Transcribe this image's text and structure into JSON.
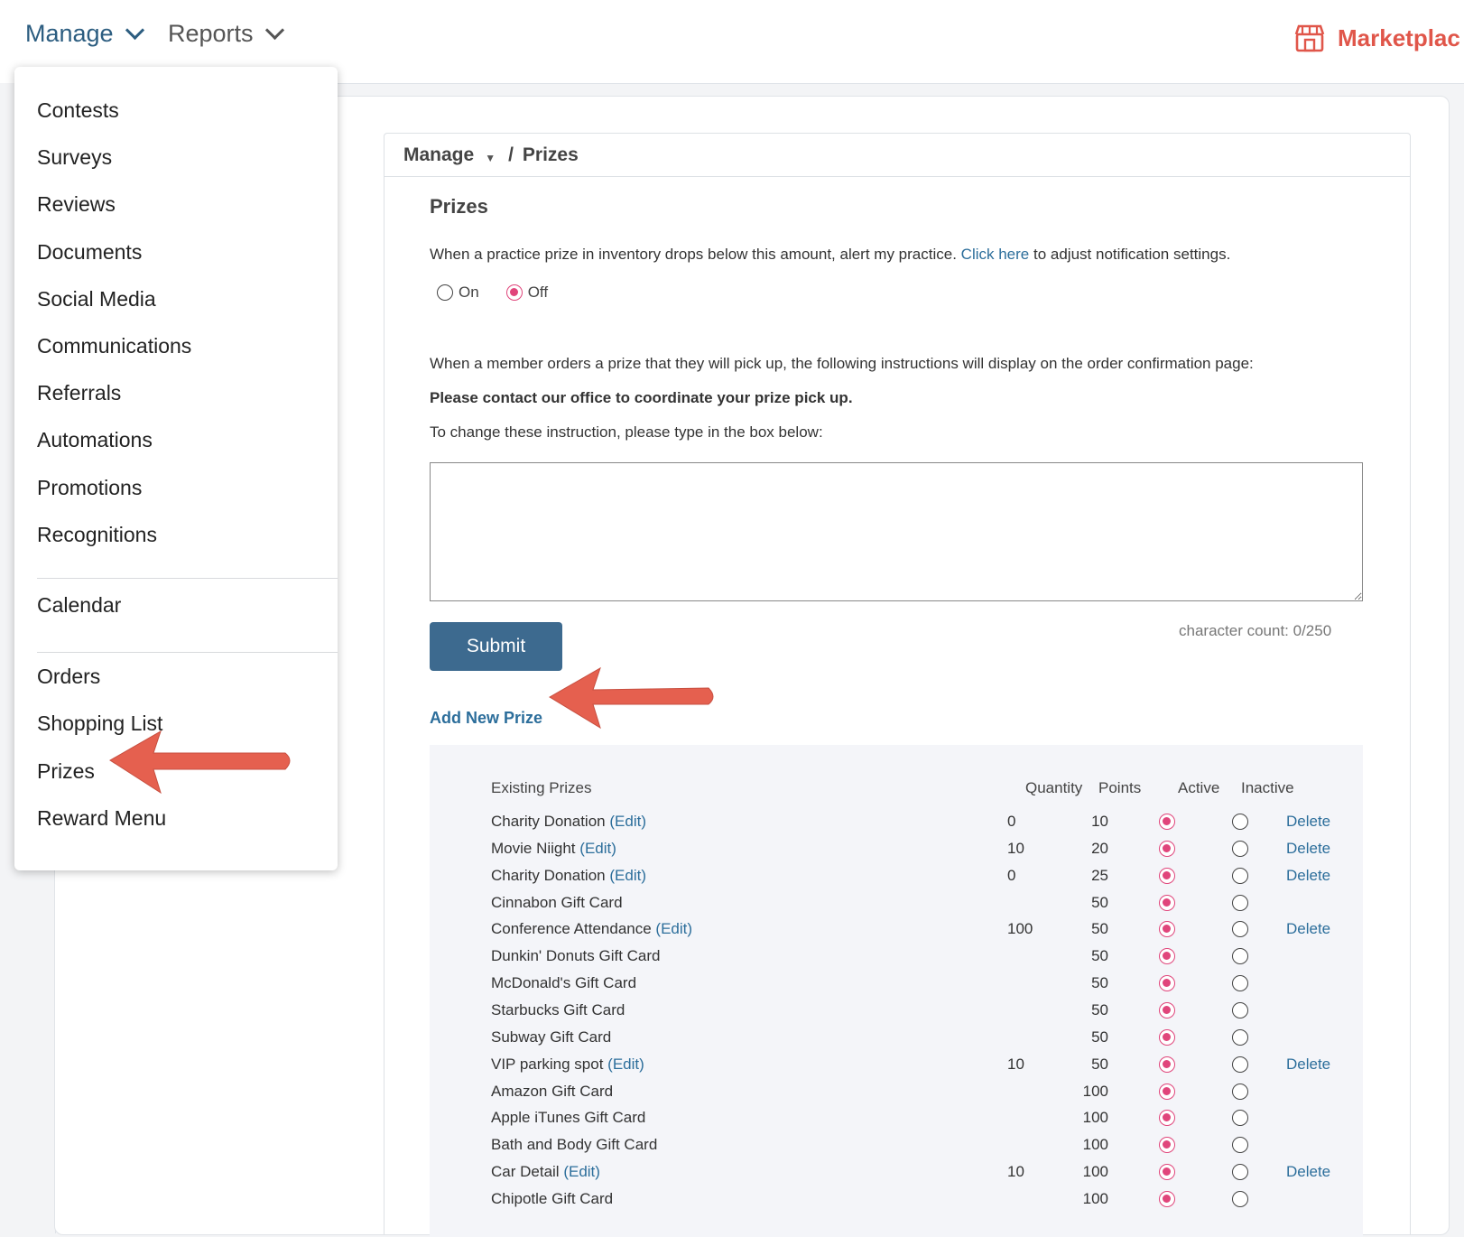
{
  "nav": {
    "manage_label": "Manage",
    "reports_label": "Reports",
    "marketplace_label": "Marketplac"
  },
  "breadcrumb": {
    "parent": "Manage",
    "separator": "/",
    "current": "Prizes"
  },
  "page": {
    "title": "Prizes",
    "alert_text_before": "When a practice prize in inventory drops below this amount, alert my practice.",
    "alert_link": "Click here",
    "alert_text_after": "to adjust notification settings.",
    "radio_on_label": "On",
    "radio_off_label": "Off",
    "pickup_intro": "When a member orders a prize that they will pick up, the following instructions will display on the order confirmation page:",
    "pickup_instruction": "Please contact our office to coordinate your prize pick up.",
    "change_instruction": "To change these instruction, please type in the box below:",
    "textarea_value": "",
    "submit_label": "Submit",
    "char_count": "character count: 0/250",
    "add_new_prize": "Add New Prize"
  },
  "table": {
    "headers": {
      "name": "Existing Prizes",
      "quantity": "Quantity",
      "points": "Points",
      "active": "Active",
      "inactive": "Inactive"
    },
    "rows": [
      {
        "name": "Charity Donation",
        "edit": "(Edit)",
        "quantity": "0",
        "points": "10",
        "active": true,
        "delete": "Delete"
      },
      {
        "name": "Movie Niight",
        "edit": "(Edit)",
        "quantity": "10",
        "points": "20",
        "active": true,
        "delete": "Delete"
      },
      {
        "name": "Charity Donation",
        "edit": "(Edit)",
        "quantity": "0",
        "points": "25",
        "active": true,
        "delete": "Delete"
      },
      {
        "name": "Cinnabon Gift Card",
        "edit": "",
        "quantity": "",
        "points": "50",
        "active": true,
        "delete": ""
      },
      {
        "name": "Conference Attendance",
        "edit": "(Edit)",
        "quantity": "100",
        "points": "50",
        "active": true,
        "delete": "Delete"
      },
      {
        "name": "Dunkin' Donuts Gift Card",
        "edit": "",
        "quantity": "",
        "points": "50",
        "active": true,
        "delete": ""
      },
      {
        "name": "McDonald's Gift Card",
        "edit": "",
        "quantity": "",
        "points": "50",
        "active": true,
        "delete": ""
      },
      {
        "name": "Starbucks Gift Card",
        "edit": "",
        "quantity": "",
        "points": "50",
        "active": true,
        "delete": ""
      },
      {
        "name": "Subway Gift Card",
        "edit": "",
        "quantity": "",
        "points": "50",
        "active": true,
        "delete": ""
      },
      {
        "name": "VIP parking spot",
        "edit": "(Edit)",
        "quantity": "10",
        "points": "50",
        "active": true,
        "delete": "Delete"
      },
      {
        "name": "Amazon Gift Card",
        "edit": "",
        "quantity": "",
        "points": "100",
        "active": true,
        "delete": ""
      },
      {
        "name": "Apple iTunes Gift Card",
        "edit": "",
        "quantity": "",
        "points": "100",
        "active": true,
        "delete": ""
      },
      {
        "name": "Bath and Body Gift Card",
        "edit": "",
        "quantity": "",
        "points": "100",
        "active": true,
        "delete": ""
      },
      {
        "name": "Car Detail",
        "edit": "(Edit)",
        "quantity": "10",
        "points": "100",
        "active": true,
        "delete": "Delete"
      },
      {
        "name": "Chipotle Gift Card",
        "edit": "",
        "quantity": "",
        "points": "100",
        "active": true,
        "delete": ""
      }
    ]
  },
  "menu": {
    "group1": [
      "Contests",
      "Surveys",
      "Reviews",
      "Documents",
      "Social Media",
      "Communications",
      "Referrals",
      "Automations",
      "Promotions",
      "Recognitions"
    ],
    "group2": [
      "Calendar"
    ],
    "group3": [
      "Orders",
      "Shopping List",
      "Prizes",
      "Reward Menu"
    ]
  },
  "colors": {
    "accent": "#2c6e9b",
    "radio_active": "#e0457b",
    "submit_bg": "#3d6a8f",
    "arrow": "#e5604f",
    "marketplace": "#e0564a"
  },
  "icons": [
    "chevron-down-icon",
    "store-icon",
    "caret-down-icon",
    "arrow-annotation-icon"
  ]
}
